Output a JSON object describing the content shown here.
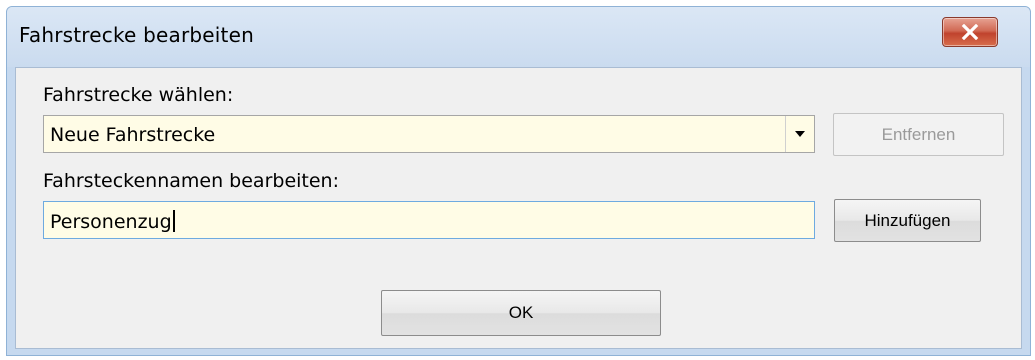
{
  "window": {
    "title": "Fahrstrecke bearbeiten"
  },
  "route_select": {
    "label": "Fahrstrecke wählen:",
    "selected_value": "Neue Fahrstrecke"
  },
  "route_name": {
    "label": "Fahrsteckennamen bearbeiten:",
    "value": "Personenzug"
  },
  "buttons": {
    "remove_label": "Entfernen",
    "add_label": "Hinzufügen",
    "ok_label": "OK"
  },
  "icons": {
    "close": "close-icon",
    "dropdown": "chevron-down-icon"
  },
  "colors": {
    "field_background": "#fffce6",
    "titlebar": "#cadbef",
    "close_button": "#c0432d",
    "focus_border": "#6eaae0"
  }
}
